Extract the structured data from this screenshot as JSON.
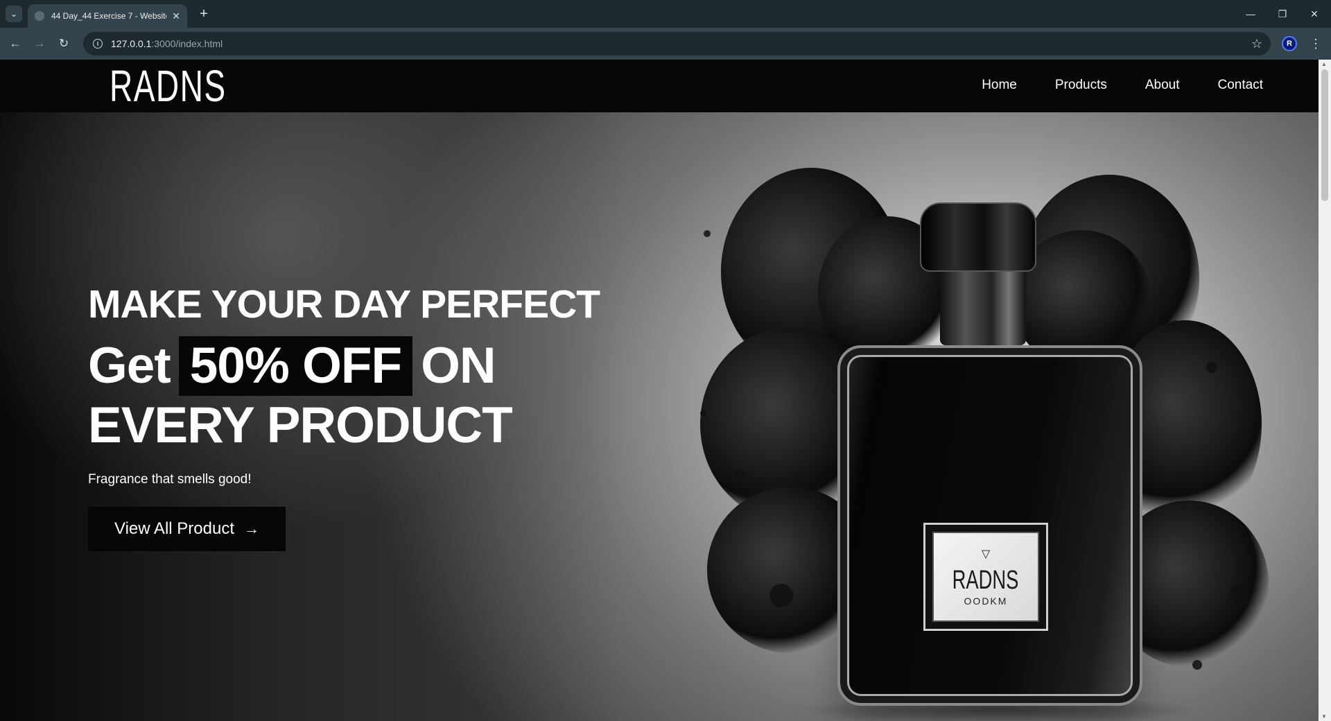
{
  "browser": {
    "tab_title": "44 Day_44 Exercise 7 - Website",
    "url_host": "127.0.0.1",
    "url_path": ":3000/index.html",
    "profile_initial": "R"
  },
  "site": {
    "logo": "RADNS",
    "nav": [
      "Home",
      "Products",
      "About",
      "Contact"
    ]
  },
  "hero": {
    "headline": "MAKE YOUR DAY PERFECT",
    "offer_prefix": "Get",
    "offer_highlight": "50% OFF",
    "offer_suffix": "ON",
    "offer_line2": "EVERY PRODUCT",
    "tagline": "Fragrance that smells good!",
    "cta_label": "View All Product",
    "cta_arrow": "→"
  },
  "bottle": {
    "label_brand": "RADNS",
    "label_sub": "OODKM",
    "label_mark": "▽"
  },
  "colors": {
    "header_bg": "#060606",
    "accent_box": "#060606",
    "chrome_bg": "#1f2a30",
    "toolbar_bg": "#34444d"
  }
}
